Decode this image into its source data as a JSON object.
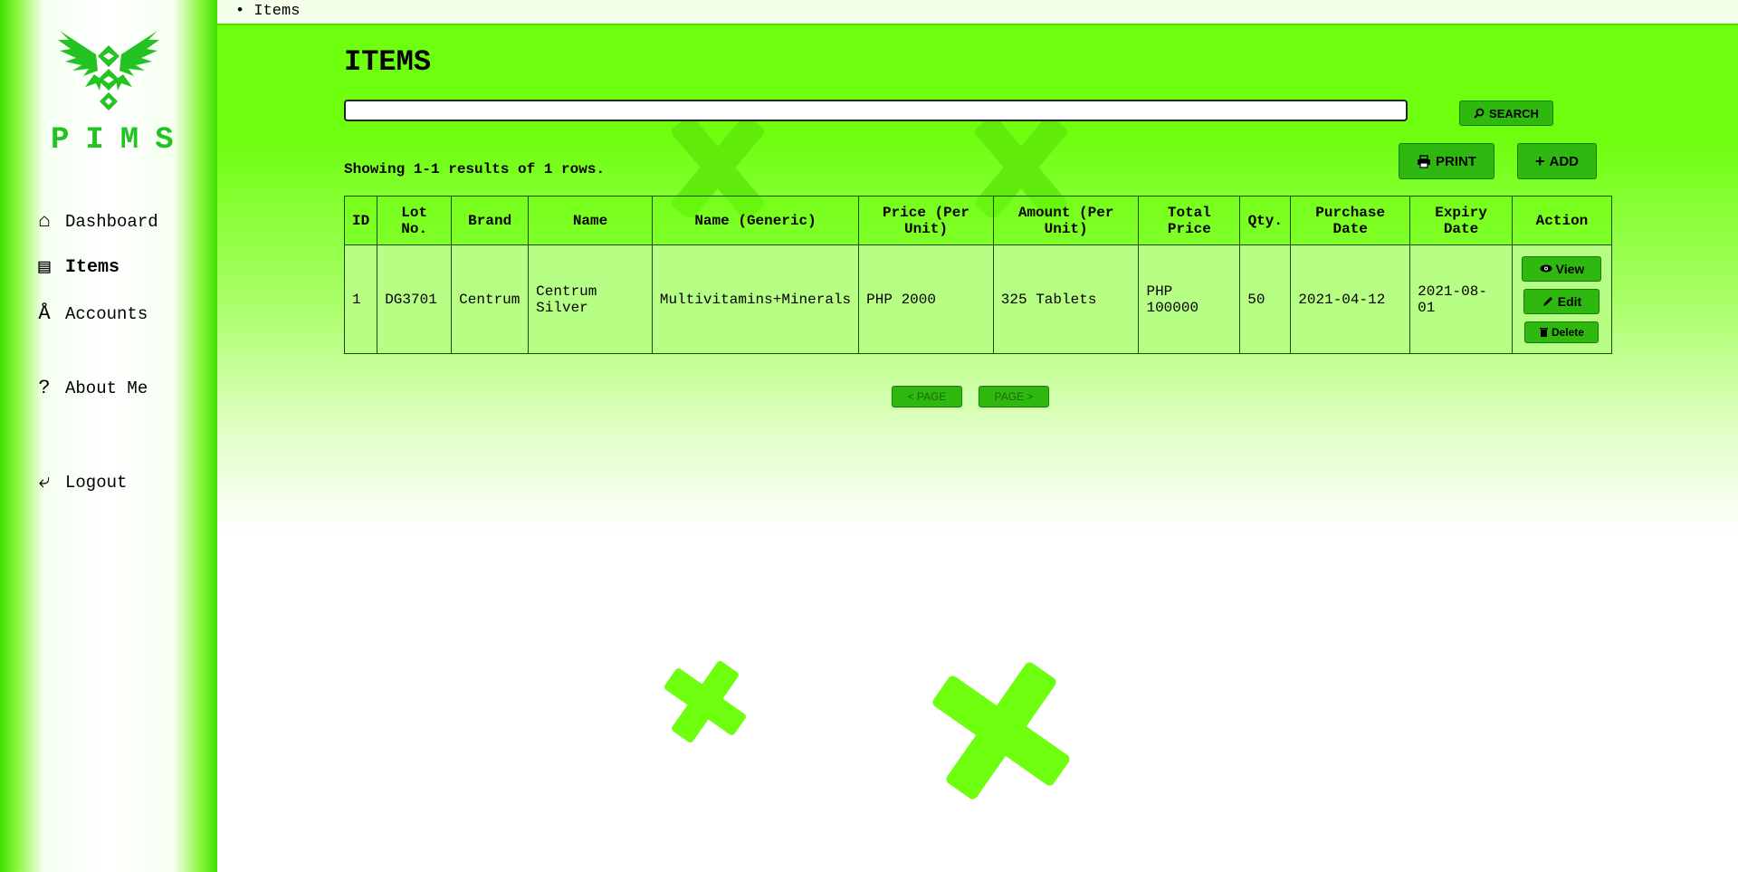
{
  "app": {
    "logo_text": "PIMS"
  },
  "sidebar": {
    "items": [
      {
        "label": "Dashboard",
        "icon": "home-icon",
        "glyph": "⌂"
      },
      {
        "label": "Items",
        "icon": "list-icon",
        "glyph": "▤"
      },
      {
        "label": "Accounts",
        "icon": "accounts-icon",
        "glyph": "Å"
      },
      {
        "label": "About Me",
        "icon": "question-icon",
        "glyph": "?"
      },
      {
        "label": "Logout",
        "icon": "logout-icon",
        "glyph": "⤶"
      }
    ]
  },
  "breadcrumb": {
    "bullet": "•",
    "current": "Items"
  },
  "main": {
    "title": "ITEMS",
    "search": {
      "value": "",
      "button_label": "SEARCH"
    },
    "print_label": "PRINT",
    "add_label": "ADD",
    "results_text": "Showing 1-1 results of 1 rows."
  },
  "table": {
    "headers": [
      "ID",
      "Lot No.",
      "Brand",
      "Name",
      "Name (Generic)",
      "Price (Per Unit)",
      "Amount (Per Unit)",
      "Total Price",
      "Qty.",
      "Purchase Date",
      "Expiry Date",
      "Action"
    ],
    "rows": [
      {
        "id": "1",
        "lot_no": "DG3701",
        "brand": "Centrum",
        "name": "Centrum Silver",
        "generic": "Multivitamins+Minerals",
        "price": "PHP 2000",
        "amount": "325 Tablets",
        "total": "PHP 100000",
        "qty": "50",
        "purchase_date": "2021-04-12",
        "expiry_date": "2021-08-01",
        "actions": {
          "view": "View",
          "edit": "Edit",
          "delete": "Delete"
        }
      }
    ]
  },
  "pagination": {
    "prev_label": "< PAGE",
    "next_label": "PAGE >"
  },
  "colors": {
    "accent": "#6dff0d",
    "button": "#2fb80f",
    "logo": "#22c322",
    "table_row": "#b7ff84"
  }
}
